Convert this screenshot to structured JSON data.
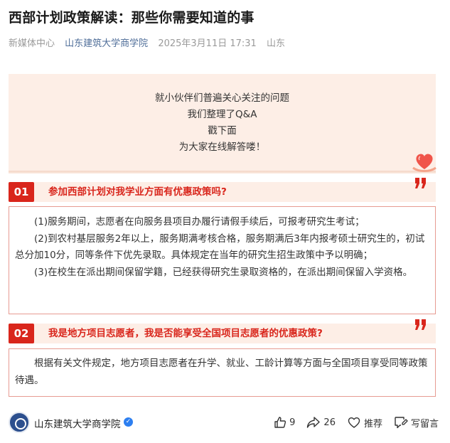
{
  "article": {
    "title": "西部计划政策解读：那些你需要知道的事",
    "meta": {
      "source": "新媒体中心",
      "account": "山东建筑大学商学院",
      "datetime": "2025年3月11日 17:31",
      "location": "山东"
    },
    "intro_lines": [
      "就小伙伴们普遍关心关注的问题",
      "我们整理了Q&A",
      "戳下面",
      "为大家在线解答喽！"
    ],
    "qa": [
      {
        "number": "01",
        "question": "参加西部计划对我学业方面有优惠政策吗?",
        "answer_paragraphs": [
          "(1)服务期间，志愿者在向服务县项目办履行请假手续后，可报考研究生考试；",
          "(2)到农村基层服务2年以上，服务期满考核合格，服务期满后3年内报考硕士研究生的，初试总分加10分，同等条件下优先录取。具体规定在当年的研究生招生政策中予以明确；",
          "(3)在校生在派出期间保留学籍，已经获得研究生录取资格的，在派出期间保留入学资格。"
        ]
      },
      {
        "number": "02",
        "question": "我是地方项目志愿者，我是否能享受全国项目志愿者的优惠政策?",
        "answer_paragraphs": [
          "根据有关文件规定，地方项目志愿者在升学、就业、工龄计算等方面与全国项目享受同等政策待遇。"
        ]
      }
    ]
  },
  "footer": {
    "account_name": "山东建筑大学商学院",
    "like_count": "9",
    "share_count": "26",
    "recommend_label": "推荐",
    "comment_label": "写留言"
  },
  "colors": {
    "accent_red": "#d9261c",
    "peach_bg": "#fdeee6",
    "link_blue": "#4f6e99"
  },
  "icons": [
    "heart-decoration-icon",
    "quote-mark-icon",
    "verified-icon",
    "thumbs-up-icon",
    "share-icon",
    "heart-icon",
    "comment-icon"
  ]
}
